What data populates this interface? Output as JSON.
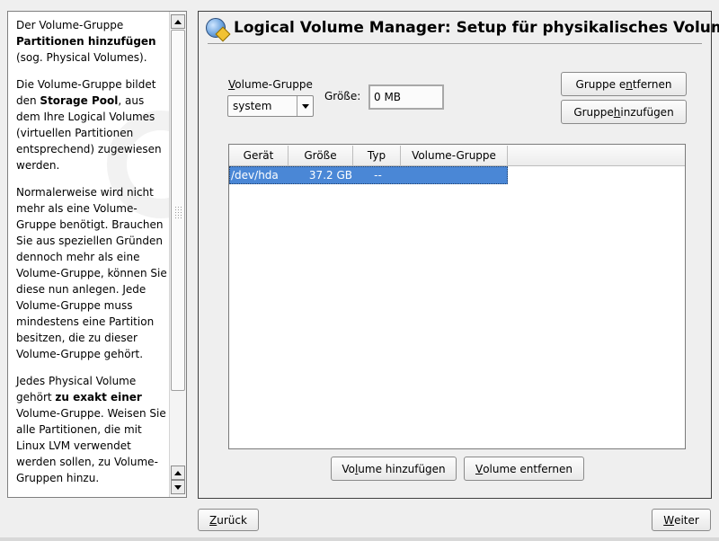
{
  "help": {
    "p1_pre": "Der Volume-Gruppe ",
    "p1_bold": "Partitionen hinzufügen",
    "p1_post": " (sog. Physical Volumes).",
    "p2_pre": "Die Volume-Gruppe bildet den ",
    "p2_bold": "Storage Pool",
    "p2_post": ", aus dem Ihre Logical Volumes (virtuellen Partitionen entsprechend) zugewiesen werden.",
    "p3": "Normalerweise wird nicht mehr als eine Volume-Gruppe benötigt. Brauchen Sie aus speziellen Gründen dennoch mehr als eine Volume-Gruppe, können Sie diese nun anlegen. Jede Volume-Gruppe muss mindestens eine Partition besitzen, die zu dieser Volume-Gruppe gehört.",
    "p4_pre": "Jedes Physical Volume gehört ",
    "p4_bold": "zu exakt einer",
    "p4_post": " Volume-Gruppe. Weisen Sie alle Partitionen, die mit Linux LVM verwendet werden sollen, zu Volume-Gruppen hinzu."
  },
  "header": {
    "title": "Logical Volume Manager: Setup für physikalisches Volume",
    "icon": "lvm-disk-icon"
  },
  "volume_group": {
    "label_mnemonic": "V",
    "label_rest": "olume-Gruppe",
    "selected": "system"
  },
  "size": {
    "label": "Größe:",
    "value": "0 MB"
  },
  "buttons": {
    "remove_group": {
      "pre": "Gruppe e",
      "mnemonic": "n",
      "post": "tfernen"
    },
    "add_group": {
      "pre": "Gruppe ",
      "mnemonic": "h",
      "post": "inzufügen"
    },
    "add_volume": {
      "pre": "Vo",
      "mnemonic": "l",
      "post": "ume hinzufügen"
    },
    "remove_volume": {
      "pre": "",
      "mnemonic": "V",
      "post": "olume entfernen"
    },
    "back": {
      "pre": "",
      "mnemonic": "Z",
      "post": "urück"
    },
    "next": {
      "pre": "",
      "mnemonic": "W",
      "post": "eiter"
    }
  },
  "table": {
    "columns": [
      "Gerät",
      "Größe",
      "Typ",
      "Volume-Gruppe"
    ],
    "rows": [
      {
        "device": "/dev/hda",
        "size": "37.2 GB",
        "type": "--",
        "group": ""
      }
    ]
  },
  "colors": {
    "selection": "#4a87d6",
    "background": "#efefef"
  }
}
